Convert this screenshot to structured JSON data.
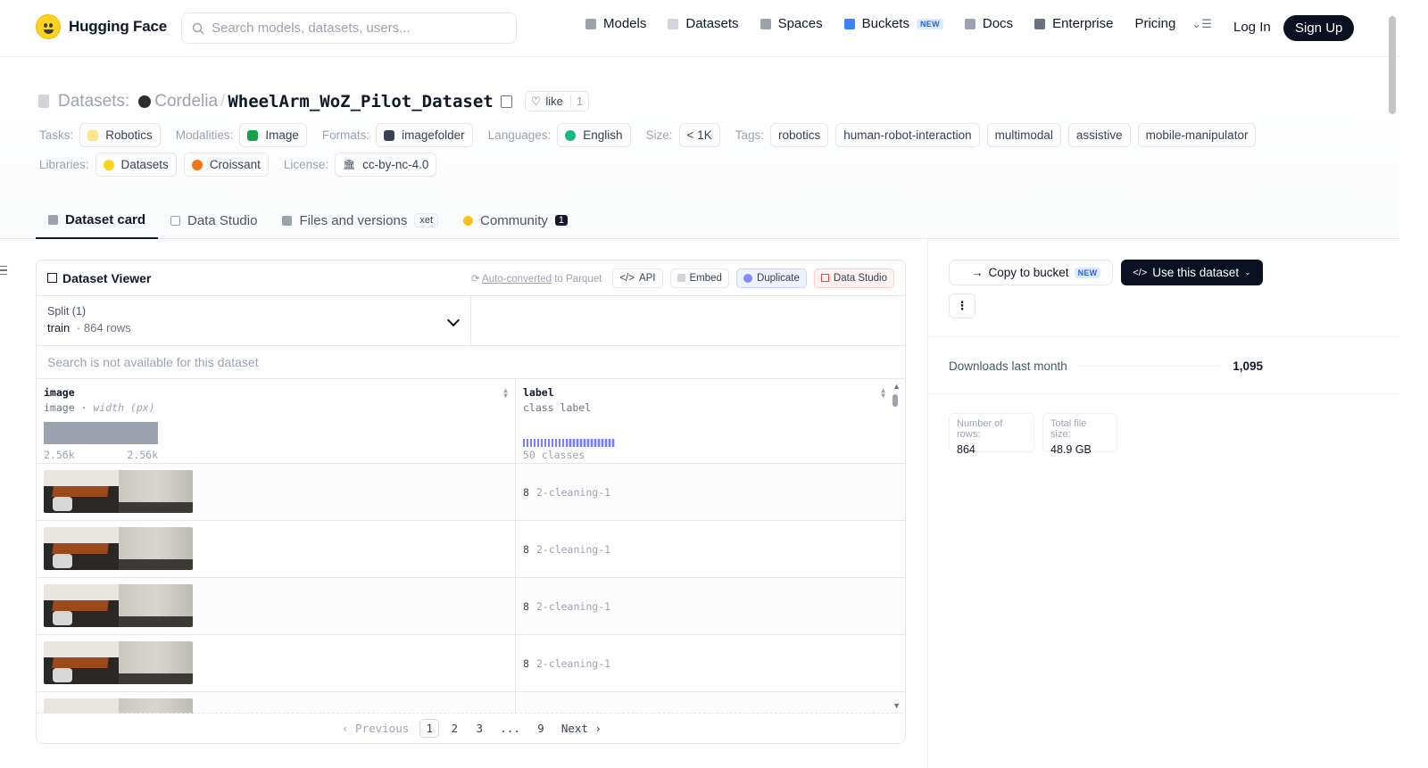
{
  "nav": {
    "brand": "Hugging Face",
    "search_placeholder": "Search models, datasets, users...",
    "links": [
      {
        "label": "Models",
        "icon": "cube-icon",
        "color": "#9ca3af"
      },
      {
        "label": "Datasets",
        "icon": "database-icon",
        "color": "#d1d5db"
      },
      {
        "label": "Spaces",
        "icon": "grid-icon",
        "color": "#9ca3af"
      },
      {
        "label": "Buckets",
        "icon": "bucket-icon",
        "color": "#3b82f6",
        "badge": "NEW"
      },
      {
        "label": "Docs",
        "icon": "book-icon",
        "color": "#9ca3af"
      },
      {
        "label": "Enterprise",
        "icon": "enterprise-icon",
        "color": "#6b7280"
      },
      {
        "label": "Pricing"
      }
    ],
    "login": "Log In",
    "signup": "Sign Up"
  },
  "repo": {
    "type_label": "Datasets:",
    "owner": "Cordelia",
    "name": "WheelArm_WoZ_Pilot_Dataset",
    "like_label": "like",
    "like_count": "1"
  },
  "tags": {
    "tasks_label": "Tasks:",
    "tasks": [
      "Robotics"
    ],
    "modalities_label": "Modalities:",
    "modalities": [
      "Image"
    ],
    "formats_label": "Formats:",
    "formats": [
      "imagefolder"
    ],
    "languages_label": "Languages:",
    "languages": [
      "English"
    ],
    "size_label": "Size:",
    "size": "< 1K",
    "tags_label": "Tags:",
    "tag_list": [
      "robotics",
      "human-robot-interaction",
      "multimodal",
      "assistive",
      "mobile-manipulator"
    ],
    "libraries_label": "Libraries:",
    "libraries": [
      "Datasets",
      "Croissant"
    ],
    "license_label": "License:",
    "license": "cc-by-nc-4.0"
  },
  "tabs": [
    {
      "label": "Dataset card",
      "active": true
    },
    {
      "label": "Data Studio"
    },
    {
      "label": "Files and versions",
      "badge": "xet"
    },
    {
      "label": "Community",
      "count": "1"
    }
  ],
  "viewer": {
    "title": "Dataset Viewer",
    "auto_converted": "Auto-converted",
    "to_parquet": " to Parquet",
    "actions": [
      "API",
      "Embed",
      "Duplicate",
      "Data Studio"
    ],
    "split_label": "Split (1)",
    "split_value": "train",
    "split_rows": "864 rows",
    "search_unavailable": "Search is not available for this dataset",
    "columns": [
      {
        "name": "image",
        "type": "image",
        "stat": "width (px)",
        "min": "2.56k",
        "max": "2.56k"
      },
      {
        "name": "label",
        "type": "class label",
        "stat": "50 classes"
      }
    ],
    "rows": [
      {
        "label_id": "8",
        "label_name": "2-cleaning-1"
      },
      {
        "label_id": "8",
        "label_name": "2-cleaning-1"
      },
      {
        "label_id": "8",
        "label_name": "2-cleaning-1"
      },
      {
        "label_id": "8",
        "label_name": "2-cleaning-1"
      },
      {
        "label_id": "",
        "label_name": ""
      }
    ],
    "pagination": {
      "previous": "Previous",
      "pages": [
        "1",
        "2",
        "3",
        "...",
        "9"
      ],
      "current": "1",
      "next": "Next"
    }
  },
  "sidebar": {
    "copy_to_bucket": "Copy to bucket",
    "copy_badge": "NEW",
    "use_dataset": "Use this dataset",
    "downloads_label": "Downloads last month",
    "downloads_value": "1,095",
    "num_rows_label": "Number of rows:",
    "num_rows_value": "864",
    "file_size_label": "Total file size:",
    "file_size_value": "48.9 GB"
  }
}
